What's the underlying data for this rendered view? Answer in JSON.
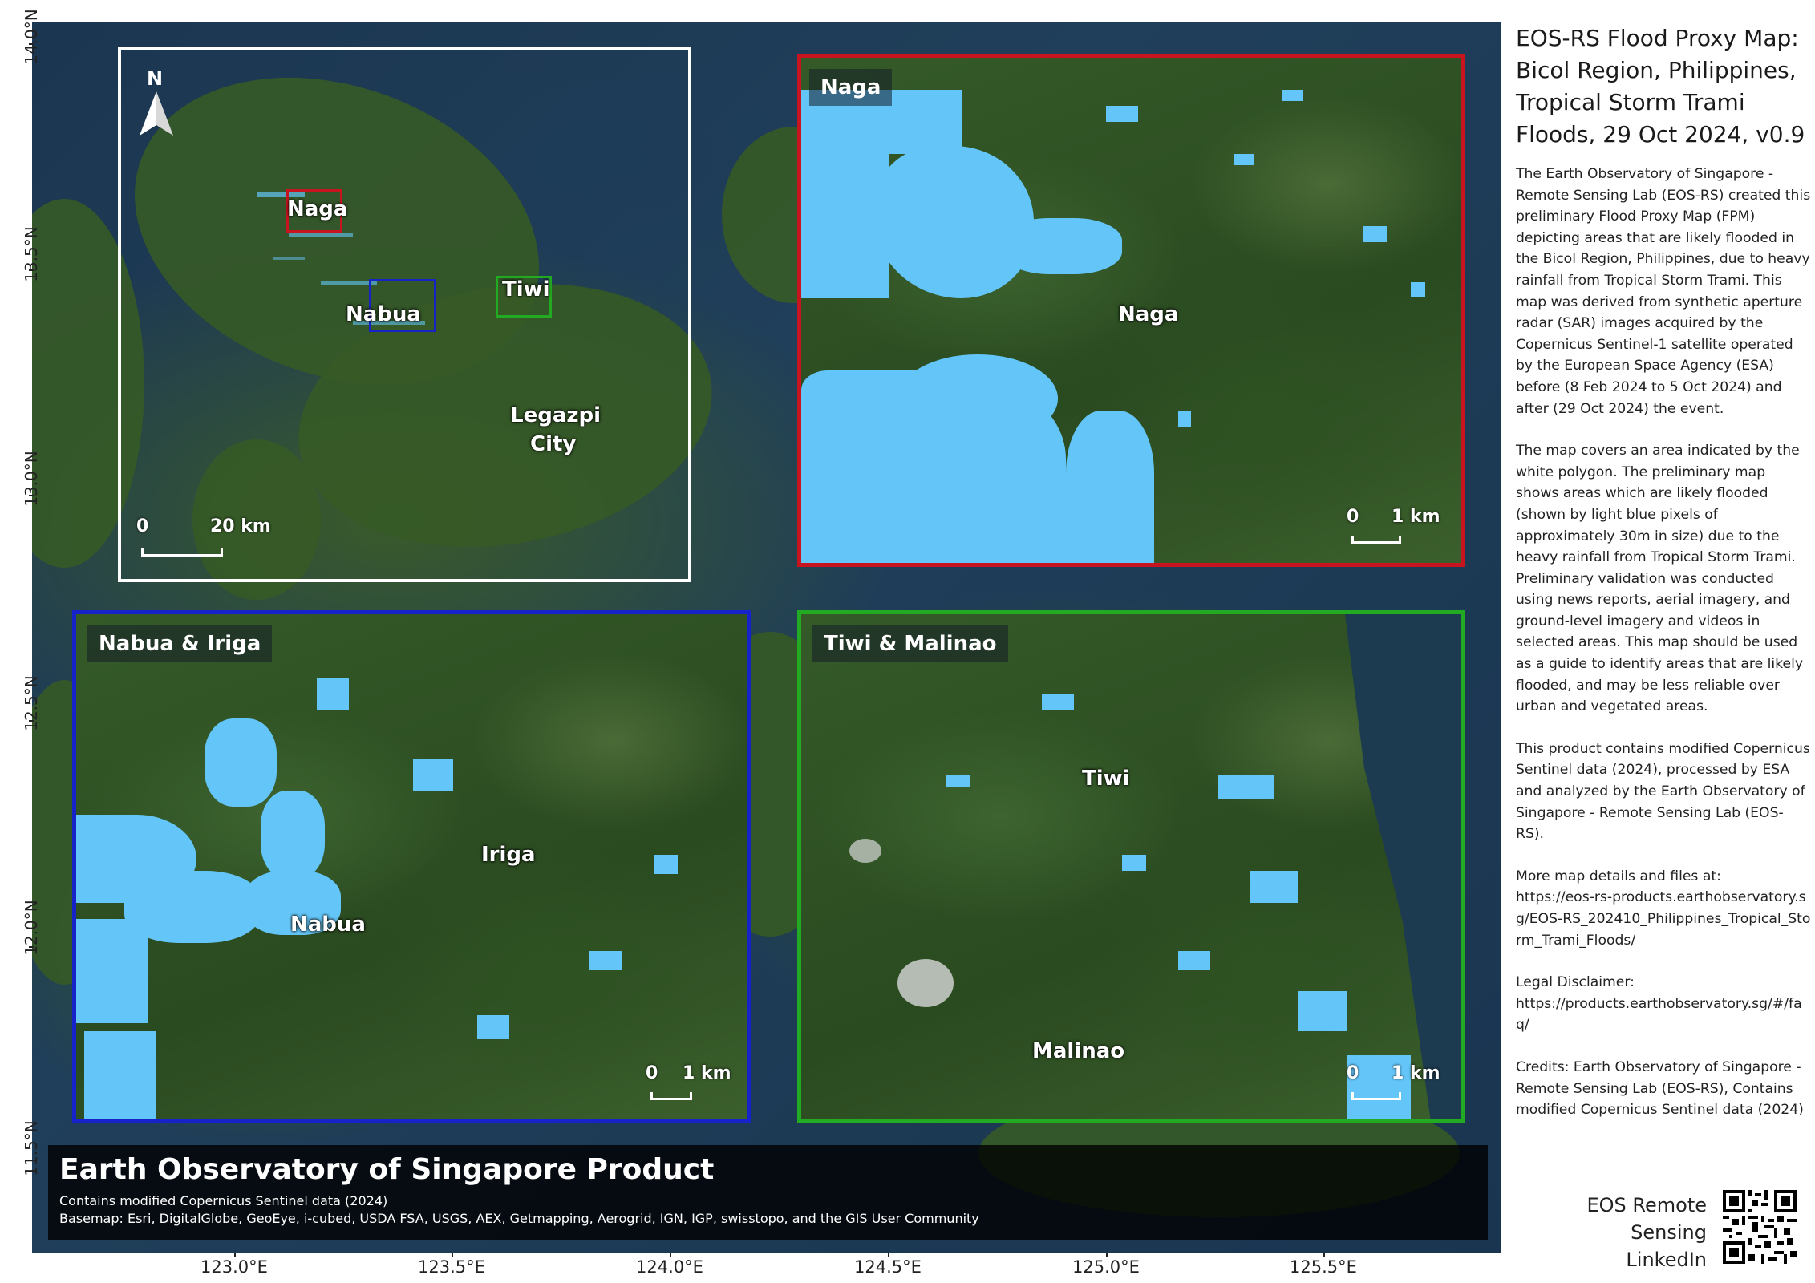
{
  "map": {
    "north_label": "N",
    "y_ticks": [
      "14.0°N",
      "13.5°N",
      "13.0°N",
      "12.5°N",
      "12.0°N",
      "11.5°N"
    ],
    "x_ticks": [
      "123.0°E",
      "123.5°E",
      "124.0°E",
      "124.5°E",
      "125.0°E",
      "125.5°E"
    ],
    "colors": {
      "flood": "#64c6f8",
      "naga_frame": "#c8141e",
      "nabua_frame": "#1623c8",
      "tiwi_frame": "#22aa22",
      "overview_frame": "#ffffff"
    },
    "overview": {
      "labels": {
        "naga": "Naga",
        "nabua": "Nabua",
        "tiwi": "Tiwi",
        "legazpi_1": "Legazpi",
        "legazpi_2": "City"
      },
      "scale": {
        "zero": "0",
        "value": "20 km"
      }
    },
    "panels": {
      "naga": {
        "title": "Naga",
        "label": "Naga",
        "scale_zero": "0",
        "scale_value": "1 km"
      },
      "nabua": {
        "title": "Nabua & Iriga",
        "label_iriga": "Iriga",
        "label_nabua": "Nabua",
        "scale_zero": "0",
        "scale_value": "1 km"
      },
      "tiwi": {
        "title": "Tiwi & Malinao",
        "label_tiwi": "Tiwi",
        "label_malinao": "Malinao",
        "scale_zero": "0",
        "scale_value": "1 km"
      }
    }
  },
  "footer": {
    "title": "Earth Observatory of Singapore Product",
    "line1": "Contains modified Copernicus Sentinel data (2024)",
    "line2": "Basemap: Esri, DigitalGlobe, GeoEye, i-cubed, USDA FSA, USGS, AEX, Getmapping, Aerogrid, IGN, IGP, swisstopo, and the GIS User Community"
  },
  "sidebar": {
    "title": "EOS-RS Flood Proxy Map: Bicol Region, Philippines, Tropical Storm Trami Floods, 29 Oct 2024, v0.9",
    "para1": "The Earth Observatory of Singapore - Remote Sensing Lab (EOS-RS) created this preliminary Flood Proxy Map (FPM) depicting areas that are likely flooded in the Bicol Region, Philippines, due to heavy rainfall from Tropical Storm Trami. This map was derived from synthetic aperture radar (SAR) images acquired by the Copernicus Sentinel-1 satellite operated by the European Space Agency (ESA) before (8 Feb 2024 to 5 Oct 2024) and after (29 Oct 2024) the event.",
    "para2": "The map covers an area indicated by the white polygon. The preliminary map shows areas which are likely flooded (shown by light blue pixels of approximately 30m in size) due to the heavy rainfall from Tropical Storm Trami. Preliminary validation was conducted using news reports, aerial imagery, and ground-level imagery and videos in selected areas. This map should be used as a guide to identify areas that are likely flooded, and may be less reliable over urban and vegetated areas.",
    "para3": "This product contains modified Copernicus Sentinel data (2024), processed by ESA and analyzed by the Earth Observatory of Singapore - Remote Sensing Lab (EOS-RS).",
    "para4_label": "More map details and files at:",
    "para4_url": "https://eos-rs-products.earthobservatory.sg/EOS-RS_202410_Philippines_Tropical_Storm_Trami_Floods/",
    "para5_label": "Legal Disclaimer:",
    "para5_url": "https://products.earthobservatory.sg/#/faq/",
    "para6": "Credits: Earth Observatory of Singapore - Remote Sensing Lab (EOS-RS), Contains modified Copernicus Sentinel data (2024)",
    "linkedin_line1": "EOS Remote Sensing",
    "linkedin_line2": "LinkedIn"
  }
}
